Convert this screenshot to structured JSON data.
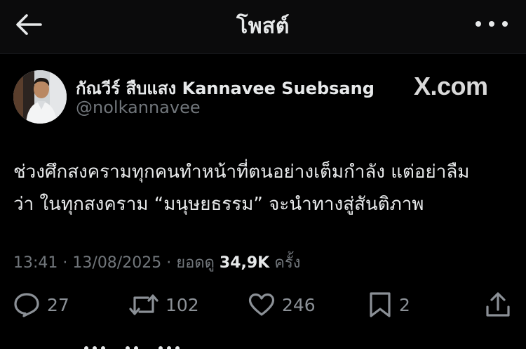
{
  "header": {
    "title": "โพสต์",
    "back_icon": "arrow-left-icon",
    "more_icon": "more-horizontal-icon"
  },
  "author": {
    "display_name": "กัณวีร์ สืบแสง Kannavee Suebsang",
    "handle": "@nolkannavee",
    "avatar_icon": "avatar-photo"
  },
  "brand": {
    "watermark": "X.com"
  },
  "tweet": {
    "lines": [
      "ช่วงศึกสงครามทุกคนทำหน้าที่ตนอย่างเต็มกำลัง แต่อย่าลืม",
      "ว่า ในทุกสงคราม “มนุษยธรรม” จะนำทางสู่สันติภาพ"
    ]
  },
  "meta": {
    "time": "13:41",
    "separator": "·",
    "date": "13/08/2025",
    "views_label": "ยอดดู",
    "views_count": "34,9K",
    "views_suffix": "ครั้ง"
  },
  "actions": {
    "replies": "27",
    "reposts": "102",
    "likes": "246",
    "bookmarks": "2"
  },
  "colors": {
    "background": "#000000",
    "header_bg": "#0b0b0c",
    "text_primary": "#e7e9ea",
    "text_secondary": "#71767b",
    "icon": "#8b9096"
  }
}
